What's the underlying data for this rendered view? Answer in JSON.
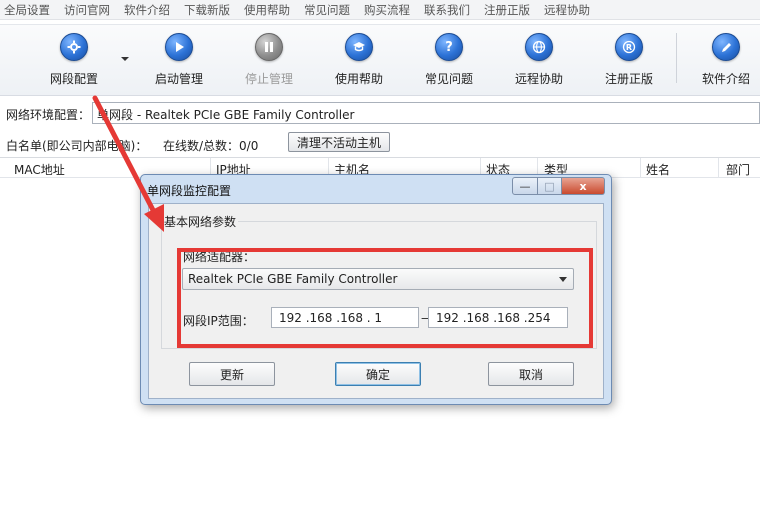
{
  "menubar": {
    "items": [
      "全局设置",
      "访问官网",
      "软件介绍",
      "下载新版",
      "使用帮助",
      "常见问题",
      "购买流程",
      "联系我们",
      "注册正版",
      "远程协助"
    ]
  },
  "toolbar": {
    "items": [
      {
        "label": "网段配置",
        "icon": "gear-icon",
        "enabled": true
      },
      {
        "label": "启动管理",
        "icon": "play-icon",
        "enabled": true
      },
      {
        "label": "停止管理",
        "icon": "pause-icon",
        "enabled": false
      },
      {
        "label": "使用帮助",
        "icon": "graduation-cap-icon",
        "enabled": true
      },
      {
        "label": "常见问题",
        "icon": "question-icon",
        "enabled": true
      },
      {
        "label": "远程协助",
        "icon": "globe-icon",
        "enabled": true
      },
      {
        "label": "注册正版",
        "icon": "registered-icon",
        "enabled": true
      },
      {
        "label": "软件介绍",
        "icon": "edit-icon",
        "enabled": true
      }
    ]
  },
  "env": {
    "label": "网络环境配置：",
    "value": "单网段 - Realtek PCIe GBE Family Controller"
  },
  "whitelist": {
    "label": "白名单(即公司内部电脑)：",
    "count": "在线数/总数：0/0",
    "clear_button": "清理不活动主机"
  },
  "table": {
    "columns": [
      "MAC地址",
      "IP地址",
      "主机名",
      "状态",
      "类型",
      "姓名",
      "部门"
    ]
  },
  "dialog": {
    "title": "单网段监控配置",
    "group_title": "基本网络参数",
    "adapter_label": "网络适配器：",
    "adapter_value": "Realtek PCIe GBE Family Controller",
    "range_label": "网段IP范围：",
    "ip_start": "192 .168 .168 . 1",
    "ip_end": "192 .168 .168 .254",
    "range_sep": "—",
    "buttons": {
      "refresh": "更新",
      "ok": "确定",
      "cancel": "取消"
    },
    "window_buttons": {
      "minimize": "—",
      "maximize": "□",
      "close": "x"
    }
  },
  "colors": {
    "annotation_red": "#e53935",
    "accent_blue": "#2c72d6"
  }
}
